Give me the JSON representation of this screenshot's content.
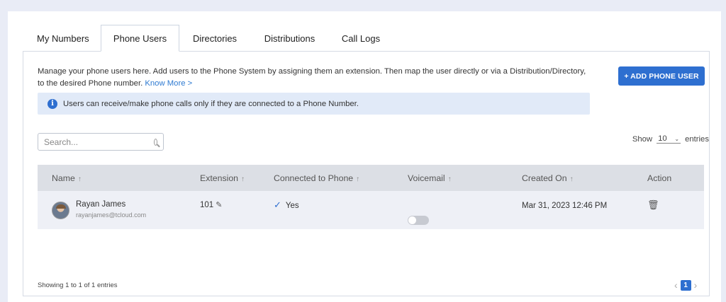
{
  "tabs": [
    {
      "label": "My Numbers"
    },
    {
      "label": "Phone Users"
    },
    {
      "label": "Directories"
    },
    {
      "label": "Distributions"
    },
    {
      "label": "Call Logs"
    }
  ],
  "description": {
    "text": "Manage your phone users here. Add users to the Phone System by assigning them an extension. Then map the user directly or via a Distribution/Directory, to the desired Phone number.",
    "link": "Know More >"
  },
  "add_button": "+ ADD PHONE USER",
  "info_banner": "Users can receive/make phone calls only if they are connected to a Phone Number.",
  "search": {
    "placeholder": "Search..."
  },
  "show_entries": {
    "prefix": "Show",
    "value": "10",
    "suffix": "entries"
  },
  "table": {
    "headers": {
      "name": "Name",
      "extension": "Extension",
      "connected": "Connected to Phone",
      "voicemail": "Voicemail",
      "created": "Created On",
      "action": "Action"
    },
    "rows": [
      {
        "name": "Rayan James",
        "email": "rayanjames@tcloud.com",
        "extension": "101",
        "connected": "Yes",
        "voicemail_on": false,
        "created": "Mar 31, 2023 12:46 PM"
      }
    ]
  },
  "footer": "Showing 1 to 1 of 1 entries",
  "pagination": {
    "current": "1"
  },
  "colors": {
    "primary": "#2e6fd0",
    "background": "#e9ecf6",
    "header": "#dcdfe5"
  }
}
